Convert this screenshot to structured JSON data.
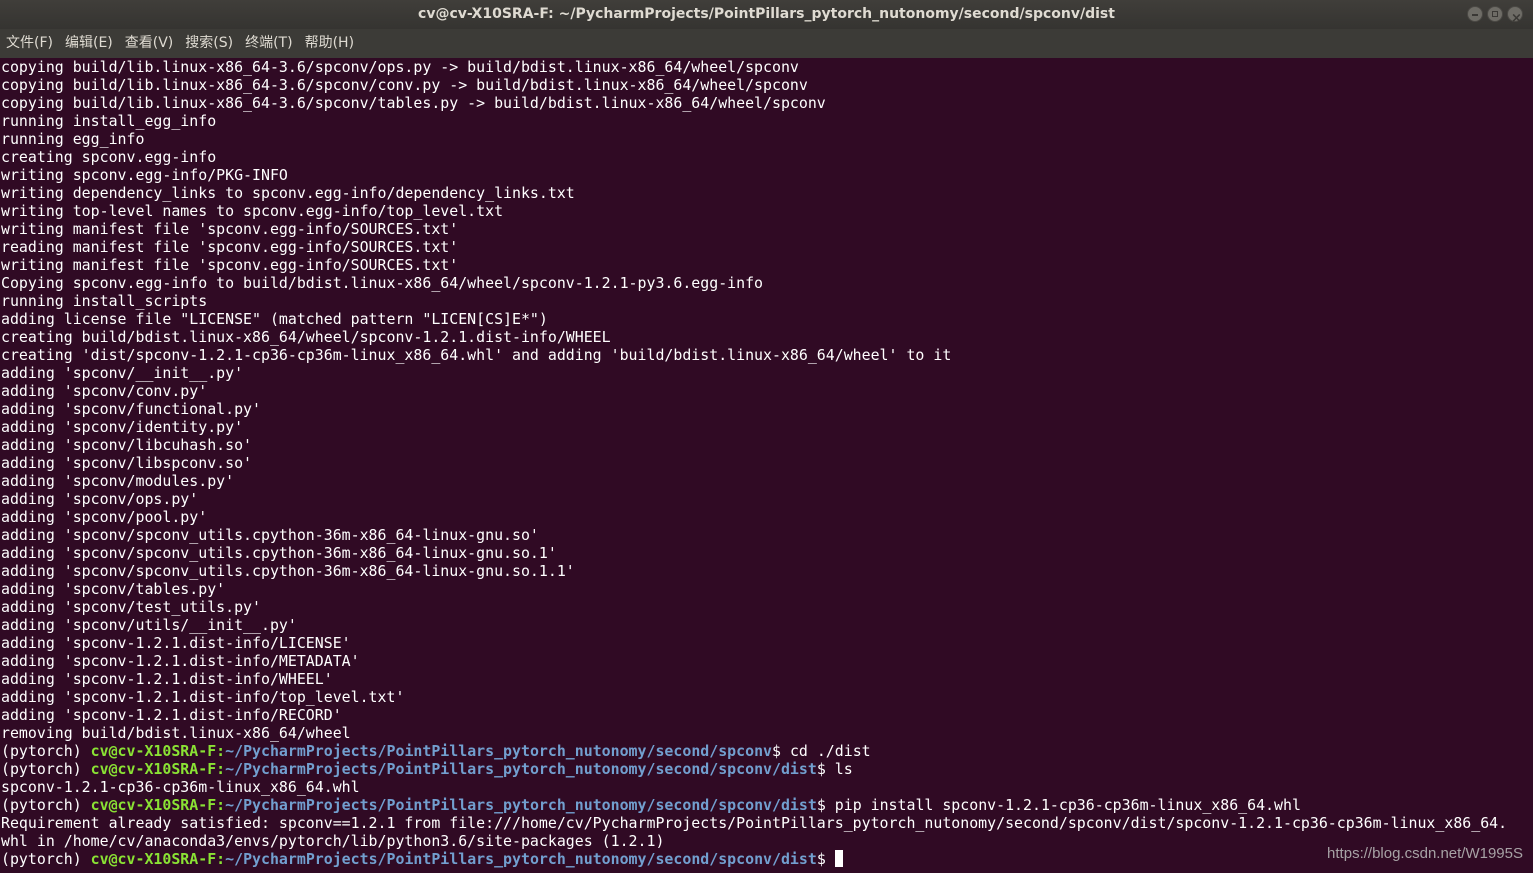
{
  "window": {
    "title": "cv@cv-X10SRA-F: ~/PycharmProjects/PointPillars_pytorch_nutonomy/second/spconv/dist",
    "controls": [
      "minimize-icon",
      "maximize-icon",
      "close-icon"
    ]
  },
  "menubar": {
    "items": [
      {
        "label": "文件(F)"
      },
      {
        "label": "编辑(E)"
      },
      {
        "label": "查看(V)"
      },
      {
        "label": "搜索(S)"
      },
      {
        "label": "终端(T)"
      },
      {
        "label": "帮助(H)"
      }
    ]
  },
  "terminal": {
    "output_lines": [
      "copying build/lib.linux-x86_64-3.6/spconv/ops.py -> build/bdist.linux-x86_64/wheel/spconv",
      "copying build/lib.linux-x86_64-3.6/spconv/conv.py -> build/bdist.linux-x86_64/wheel/spconv",
      "copying build/lib.linux-x86_64-3.6/spconv/tables.py -> build/bdist.linux-x86_64/wheel/spconv",
      "running install_egg_info",
      "running egg_info",
      "creating spconv.egg-info",
      "writing spconv.egg-info/PKG-INFO",
      "writing dependency_links to spconv.egg-info/dependency_links.txt",
      "writing top-level names to spconv.egg-info/top_level.txt",
      "writing manifest file 'spconv.egg-info/SOURCES.txt'",
      "reading manifest file 'spconv.egg-info/SOURCES.txt'",
      "writing manifest file 'spconv.egg-info/SOURCES.txt'",
      "Copying spconv.egg-info to build/bdist.linux-x86_64/wheel/spconv-1.2.1-py3.6.egg-info",
      "running install_scripts",
      "adding license file \"LICENSE\" (matched pattern \"LICEN[CS]E*\")",
      "creating build/bdist.linux-x86_64/wheel/spconv-1.2.1.dist-info/WHEEL",
      "creating 'dist/spconv-1.2.1-cp36-cp36m-linux_x86_64.whl' and adding 'build/bdist.linux-x86_64/wheel' to it",
      "adding 'spconv/__init__.py'",
      "adding 'spconv/conv.py'",
      "adding 'spconv/functional.py'",
      "adding 'spconv/identity.py'",
      "adding 'spconv/libcuhash.so'",
      "adding 'spconv/libspconv.so'",
      "adding 'spconv/modules.py'",
      "adding 'spconv/ops.py'",
      "adding 'spconv/pool.py'",
      "adding 'spconv/spconv_utils.cpython-36m-x86_64-linux-gnu.so'",
      "adding 'spconv/spconv_utils.cpython-36m-x86_64-linux-gnu.so.1'",
      "adding 'spconv/spconv_utils.cpython-36m-x86_64-linux-gnu.so.1.1'",
      "adding 'spconv/tables.py'",
      "adding 'spconv/test_utils.py'",
      "adding 'spconv/utils/__init__.py'",
      "adding 'spconv-1.2.1.dist-info/LICENSE'",
      "adding 'spconv-1.2.1.dist-info/METADATA'",
      "adding 'spconv-1.2.1.dist-info/WHEEL'",
      "adding 'spconv-1.2.1.dist-info/top_level.txt'",
      "adding 'spconv-1.2.1.dist-info/RECORD'",
      "removing build/bdist.linux-x86_64/wheel"
    ],
    "session": [
      {
        "env": "(pytorch) ",
        "user": "cv@cv-X10SRA-F",
        "sep": ":",
        "path": "~/PycharmProjects/PointPillars_pytorch_nutonomy/second/spconv",
        "cmd": "$ cd ./dist"
      },
      {
        "env": "(pytorch) ",
        "user": "cv@cv-X10SRA-F",
        "sep": ":",
        "path": "~/PycharmProjects/PointPillars_pytorch_nutonomy/second/spconv/dist",
        "cmd": "$ ls"
      },
      {
        "output": "spconv-1.2.1-cp36-cp36m-linux_x86_64.whl"
      },
      {
        "env": "(pytorch) ",
        "user": "cv@cv-X10SRA-F",
        "sep": ":",
        "path": "~/PycharmProjects/PointPillars_pytorch_nutonomy/second/spconv/dist",
        "cmd": "$ pip install spconv-1.2.1-cp36-cp36m-linux_x86_64.whl"
      },
      {
        "output": "Requirement already satisfied: spconv==1.2.1 from file:///home/cv/PycharmProjects/PointPillars_pytorch_nutonomy/second/spconv/dist/spconv-1.2.1-cp36-cp36m-linux_x86_64."
      },
      {
        "output": "whl in /home/cv/anaconda3/envs/pytorch/lib/python3.6/site-packages (1.2.1)"
      },
      {
        "env": "(pytorch) ",
        "user": "cv@cv-X10SRA-F",
        "sep": ":",
        "path": "~/PycharmProjects/PointPillars_pytorch_nutonomy/second/spconv/dist",
        "cmd": "$ ",
        "cursor": true
      }
    ]
  },
  "watermark": "https://blog.csdn.net/W1995S",
  "colors": {
    "background": "#300a24",
    "prompt_user": "#8ae234",
    "prompt_path": "#729fcf",
    "text": "#ffffff"
  }
}
